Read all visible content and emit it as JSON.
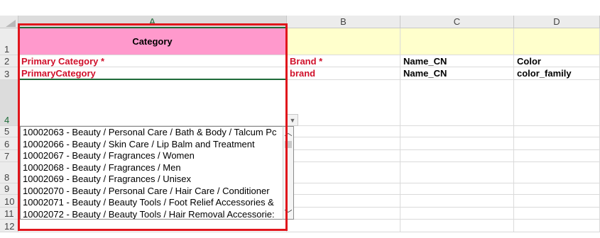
{
  "columns": [
    {
      "id": "A",
      "label": "A"
    },
    {
      "id": "B",
      "label": "B"
    },
    {
      "id": "C",
      "label": "C"
    },
    {
      "id": "D",
      "label": "D"
    }
  ],
  "rows": [
    "1",
    "2",
    "3",
    "4",
    "5",
    "6",
    "7",
    "8",
    "9",
    "10",
    "11",
    "12"
  ],
  "cells": {
    "A1": "Category",
    "A2": "Primary Category *",
    "A3": "PrimaryCategory",
    "B2": "Brand *",
    "B3": "brand",
    "C2": "Name_CN",
    "C3": "Name_CN",
    "D2": "Color",
    "D3": "color_family"
  },
  "dropdown": {
    "items": [
      "10002063 - Beauty / Personal Care / Bath & Body / Talcum Pc",
      "10002066 - Beauty / Skin Care / Lip Balm and Treatment",
      "10002067 - Beauty / Fragrances / Women",
      "10002068 - Beauty / Fragrances / Men",
      "10002069 - Beauty / Fragrances / Unisex",
      "10002070 - Beauty / Personal Care / Hair Care / Conditioner",
      "10002071 - Beauty / Beauty Tools / Foot Relief Accessories &",
      "10002072 - Beauty / Beauty Tools / Hair Removal Accessorie:"
    ],
    "arrow_icon": "chevron-down-icon",
    "scroll_up_icon": "chevron-up-icon",
    "scroll_down_icon": "chevron-down-icon"
  },
  "colors": {
    "header_pink": "#ff99cc",
    "header_yellow": "#ffffcc",
    "required_red": "#d0102a",
    "highlight_box": "#e0161c",
    "selection_green": "#1e6b39"
  }
}
